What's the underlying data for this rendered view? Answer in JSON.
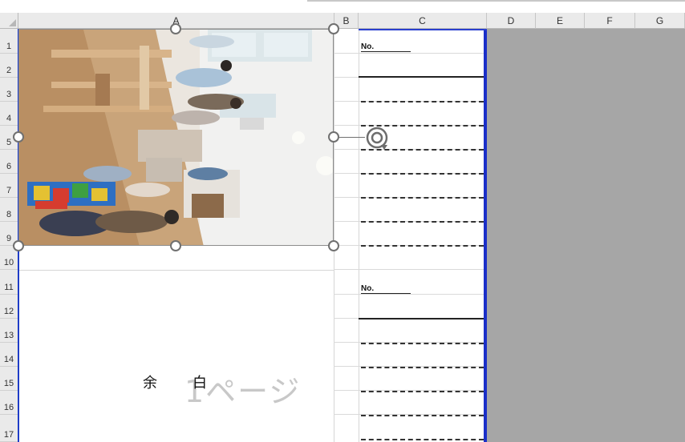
{
  "columns": [
    "A",
    "B",
    "C",
    "D",
    "E",
    "F",
    "G"
  ],
  "rows": [
    "1",
    "2",
    "3",
    "4",
    "5",
    "6",
    "7",
    "8",
    "9",
    "10",
    "11",
    "12",
    "13",
    "14",
    "15",
    "16",
    "17"
  ],
  "form_blocks": [
    {
      "no_label": "No."
    },
    {
      "no_label": "No."
    }
  ],
  "watermark": {
    "yohaku_left": "余",
    "yohaku_right": "白",
    "page_text": "1ページ"
  },
  "colors": {
    "page_border": "#1f3cc7",
    "outside_print_area": "#a6a6a6",
    "header_bg": "#eaeaea"
  },
  "icons": [
    "rotate-handle-icon",
    "resize-handle-icon",
    "select-all-triangle-icon"
  ]
}
